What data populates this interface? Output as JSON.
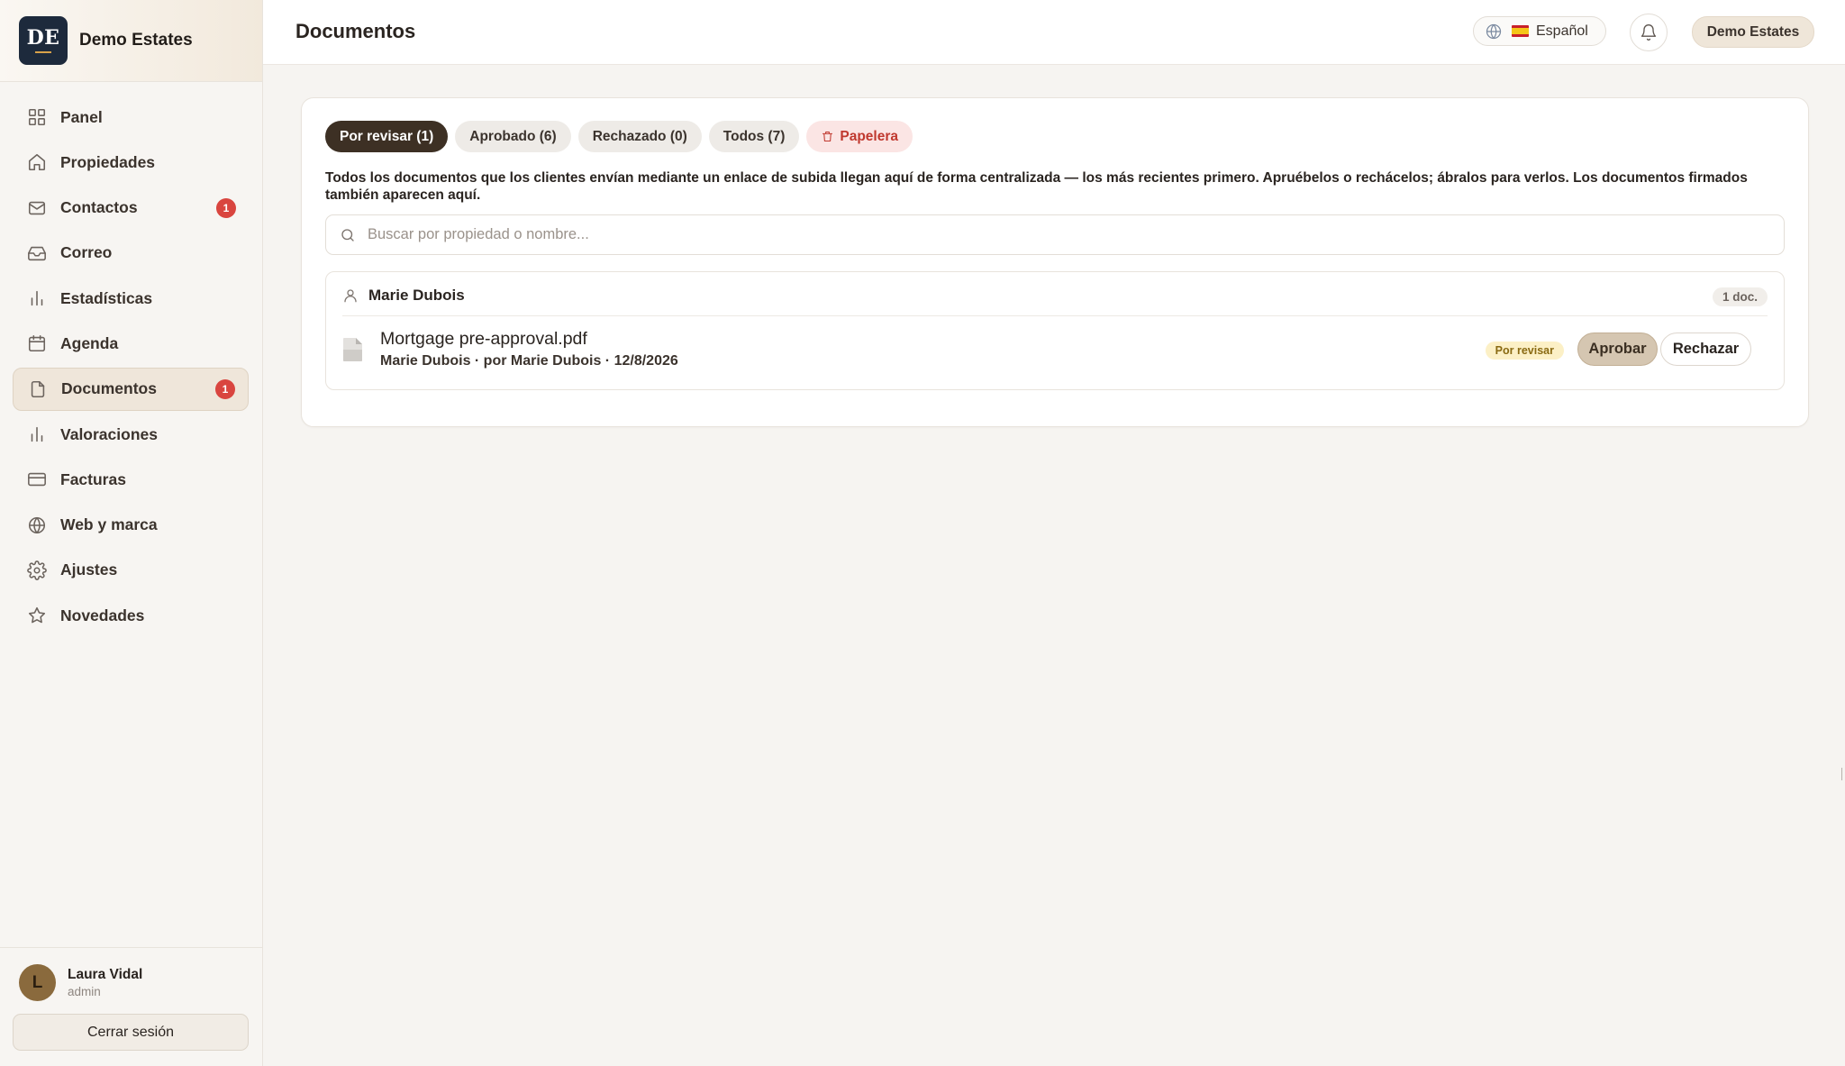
{
  "brand": {
    "logo_text": "DE",
    "name": "Demo Estates"
  },
  "sidebar": {
    "items": [
      {
        "label": "Panel",
        "icon": "grid-icon",
        "badge": ""
      },
      {
        "label": "Propiedades",
        "icon": "home-icon",
        "badge": ""
      },
      {
        "label": "Contactos",
        "icon": "mail-icon",
        "badge": "1"
      },
      {
        "label": "Correo",
        "icon": "inbox-icon",
        "badge": ""
      },
      {
        "label": "Estadísticas",
        "icon": "bar-chart-icon",
        "badge": ""
      },
      {
        "label": "Agenda",
        "icon": "calendar-icon",
        "badge": ""
      },
      {
        "label": "Documentos",
        "icon": "file-icon",
        "badge": "1",
        "active": true
      },
      {
        "label": "Valoraciones",
        "icon": "bar-chart-icon",
        "badge": ""
      },
      {
        "label": "Facturas",
        "icon": "credit-card-icon",
        "badge": ""
      },
      {
        "label": "Web y marca",
        "icon": "globe-icon",
        "badge": ""
      },
      {
        "label": "Ajustes",
        "icon": "gear-icon",
        "badge": ""
      },
      {
        "label": "Novedades",
        "icon": "star-icon",
        "badge": ""
      }
    ]
  },
  "user": {
    "initial": "L",
    "name": "Laura Vidal",
    "role": "admin",
    "logout_label": "Cerrar sesión"
  },
  "header": {
    "title": "Documentos",
    "language": "Español",
    "account": "Demo Estates"
  },
  "tabs": [
    {
      "label": "Por revisar (1)",
      "active": true
    },
    {
      "label": "Aprobado (6)"
    },
    {
      "label": "Rechazado (0)"
    },
    {
      "label": "Todos (7)"
    },
    {
      "label": "Papelera",
      "icon": "trash-icon"
    }
  ],
  "description": "Todos los documentos que los clientes envían mediante un enlace de subida llegan aquí de forma centralizada — los más recientes primero. Apruébelos o rechácelos; ábralos para verlos. Los documentos firmados también aparecen aquí.",
  "search": {
    "placeholder": "Buscar por propiedad o nombre...",
    "value": ""
  },
  "groups": [
    {
      "client": "Marie Dubois",
      "count_label": "1 doc.",
      "documents": [
        {
          "file_name": "Mortgage pre-approval.pdf",
          "meta": "Marie Dubois · por Marie Dubois · 12/8/2026",
          "status": "Por revisar",
          "approve_label": "Aprobar",
          "reject_label": "Rechazar"
        }
      ]
    }
  ],
  "colors": {
    "accent": "#3d3024",
    "badge": "#d9453f",
    "active_nav": "#efe6da",
    "trash": "#c0392f"
  }
}
